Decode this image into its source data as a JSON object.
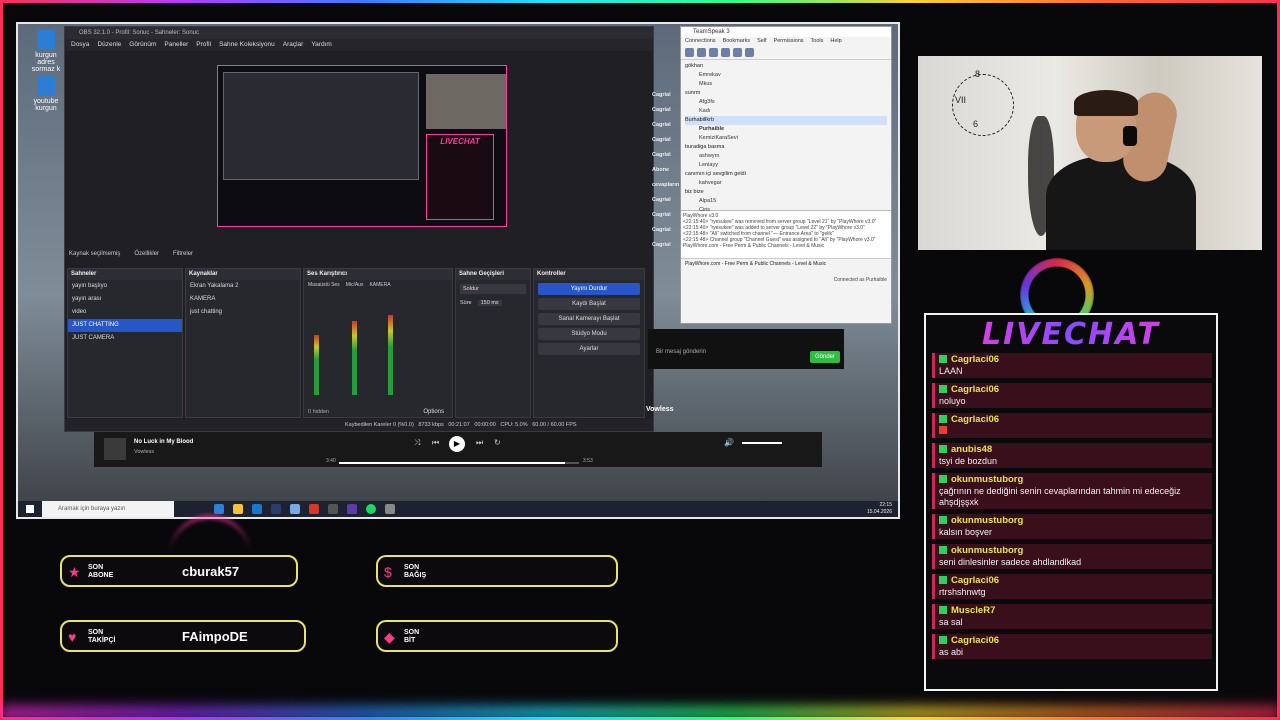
{
  "desktop": {
    "icons": [
      {
        "label": "kurgun adres sormaz k"
      },
      {
        "label": "youtube kurgun"
      }
    ]
  },
  "obs": {
    "title": "OBS 32.1.0 - Profil: Sonuc - Sahneler: Sonuc",
    "menu": [
      "Dosya",
      "Düzenle",
      "Görünüm",
      "Paneller",
      "Profil",
      "Sahne Koleksiyonu",
      "Araçlar",
      "Yardım"
    ],
    "source_bar": {
      "none_selected": "Kaynak seçilmemiş",
      "properties": "Özellikler",
      "filters": "Filtreler"
    },
    "scenes": {
      "header": "Sahneler",
      "items": [
        "yayın başlıyo",
        "yayın arası",
        "video",
        "JUST CHATTING",
        "JUST CAMERA"
      ],
      "selected": "JUST CHATTING"
    },
    "sources": {
      "header": "Kaynaklar",
      "items": [
        "Ekran Yakalama 2",
        "KAMERA",
        "just chatting"
      ]
    },
    "mixer": {
      "header": "Ses Karıştırıcı",
      "channels": [
        "Masaüstü Ses",
        "Mic/Aux",
        "KAMERA"
      ],
      "hidden": "0 hidden",
      "options": "Options"
    },
    "transitions": {
      "header": "Sahne Geçişleri",
      "type": "Soldur",
      "duration_label": "Süre",
      "duration": "150 ms"
    },
    "controls": {
      "header": "Kontroller",
      "buttons": [
        "Yayını Durdur",
        "Kaydı Başlat",
        "Sanal Kamerayı Başlat",
        "Stüdyo Modu",
        "Ayarlar"
      ]
    },
    "status": {
      "dropped": "Kaybedilen Kareler 0 (%0.0)",
      "bitrate": "8733 kbps",
      "live_time": "00:21:07",
      "rec_time": "00:00:00",
      "cpu": "CPU: 5.0%",
      "fps": "60.00 / 60.00 FPS"
    }
  },
  "teamspeak": {
    "title": "TeamSpeak 3",
    "menu": [
      "Connections",
      "Bookmarks",
      "Self",
      "Permissions",
      "Tools",
      "Help"
    ],
    "tree": [
      {
        "name": "gökhan",
        "type": "channel"
      },
      {
        "name": "Emrekav",
        "type": "user"
      },
      {
        "name": "Mkus",
        "type": "user"
      },
      {
        "name": "sunrm",
        "type": "channel"
      },
      {
        "name": "Afg3fs",
        "type": "user"
      },
      {
        "name": "Kadı",
        "type": "user"
      },
      {
        "name": "Burhabillkrb",
        "type": "channel"
      },
      {
        "name": "Purhaible",
        "type": "user"
      },
      {
        "name": "KemiziKaraSevi",
        "type": "user"
      },
      {
        "name": "buradiga basma",
        "type": "channel"
      },
      {
        "name": "ashwyrn",
        "type": "user"
      },
      {
        "name": "Leniayy",
        "type": "user"
      },
      {
        "name": "canımın içi sevgilim geldi",
        "type": "channel"
      },
      {
        "name": "kahvegar",
        "type": "user"
      },
      {
        "name": "biz bize",
        "type": "channel"
      },
      {
        "name": "Alpa15",
        "type": "user"
      },
      {
        "name": "Ciris",
        "type": "user"
      }
    ],
    "log": [
      "PlayWhore v3.0",
      "<22:15:40> \"ryesukee\" was removed from server group \"Level 21\" by \"PlayWhore v3.0\"",
      "<22:15:40> \"ryesukee\" was added to server group \"Level 22\" by \"PlayWhore v3.0\"",
      "<22:15:48> \"Ali\" switched from channel \"— Entrance Area\" to \"gelik\"",
      "<22:15:48> Channel group \"Channel Guest\" was assigned to \"Ali\" by \"PlayWhore v3.0\"",
      "PlayWhore.com - Free Perm & Public Channels - Level & Music"
    ],
    "tab": "PlayWhore.com - Free Perm & Public Channels - Level & Music",
    "connected": "Connected as Purhaible"
  },
  "side_strip": {
    "labels": [
      "Cagrial",
      "Cagrial",
      "Cagrial",
      "Cagrial",
      "Cagrial",
      "Abone",
      "cevapların",
      "Cagrial",
      "Cagrial",
      "Cagrial",
      "Cagrial"
    ]
  },
  "message_box": {
    "placeholder": "Bir mesaj gönderin",
    "send": "Gönder",
    "vowless": "Vowless"
  },
  "player": {
    "title": "No Luck in My Blood",
    "artist": "Vowless",
    "elapsed": "3:40",
    "total": "3:53",
    "progress": 0.94
  },
  "taskbar": {
    "search": "Aramak için buraya yazın",
    "time": "22:15",
    "date": "15.04.2026"
  },
  "livechat": {
    "title": "LIVECHAT",
    "messages": [
      {
        "user": "Cagrlaci06",
        "text": "LAAN"
      },
      {
        "user": "Cagrlaci06",
        "text": "noluyo"
      },
      {
        "user": "Cagrlaci06",
        "text": ""
      },
      {
        "user": "anubis48",
        "text": "tsyi de bozdun"
      },
      {
        "user": "okunmustuborg",
        "text": "çağrının ne dediğini senin cevaplarından tahmin mi edeceğiz ahşdjşşxk"
      },
      {
        "user": "okunmustuborg",
        "text": "kalsın boşver"
      },
      {
        "user": "okunmustuborg",
        "text": "seni dinlesinler sadece ahdlandlkad"
      },
      {
        "user": "Cagrlaci06",
        "text": "rtrshshnwtg"
      },
      {
        "user": "MuscleR7",
        "text": "sa sal"
      },
      {
        "user": "Cagrlaci06",
        "text": "as abi"
      }
    ]
  },
  "alerts": {
    "abone": {
      "label1": "SON",
      "label2": "ABONE",
      "value": "cburak57"
    },
    "bagis": {
      "label1": "SON",
      "label2": "BAĞIŞ",
      "value": ""
    },
    "takipci": {
      "label1": "SON",
      "label2": "TAKİPÇİ",
      "value": "FAimpoDE"
    },
    "bit": {
      "label1": "SON",
      "label2": "BİT",
      "value": ""
    }
  },
  "colors": {
    "accent_pink": "#ff3aa0",
    "alert_border": "#e7e36e",
    "obs_blue": "#2656c7",
    "chat_user": "#e6e64a",
    "chat_bg": "#3a0f1c"
  }
}
